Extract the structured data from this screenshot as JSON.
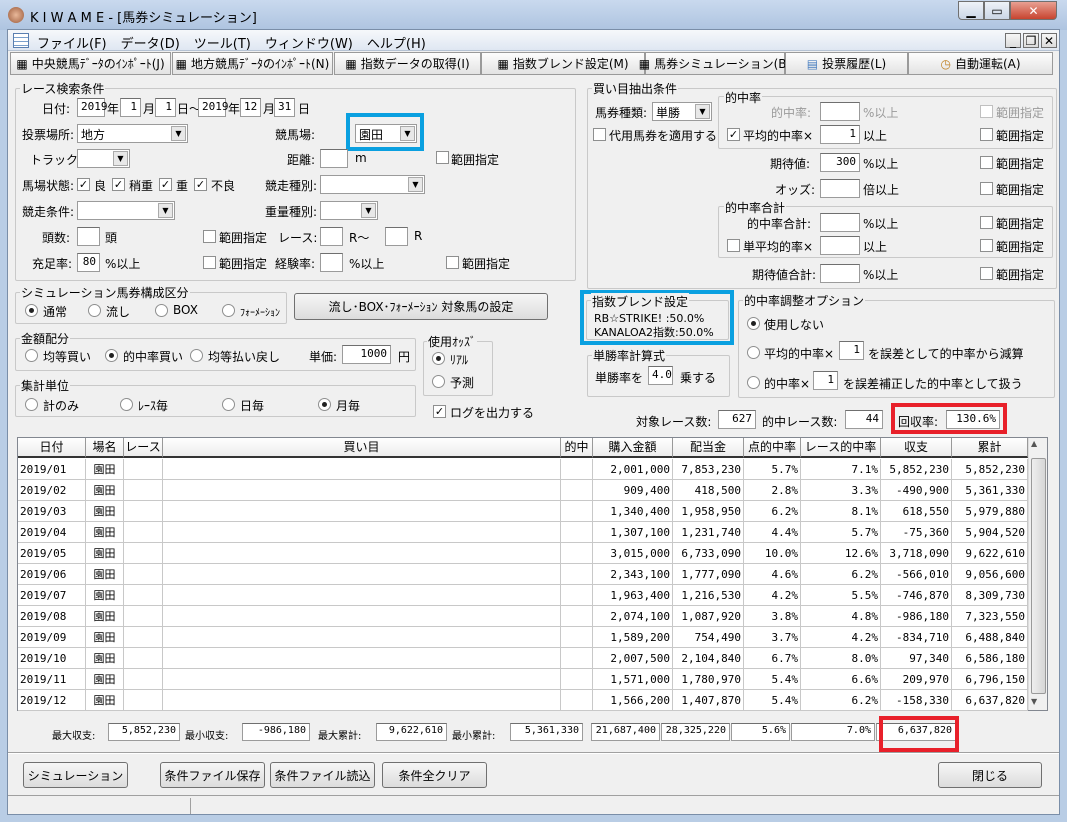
{
  "window": {
    "title": "K I W A M E - [馬券シミュレーション]"
  },
  "menu": [
    "ファイル(F)",
    "データ(D)",
    "ツール(T)",
    "ウィンドウ(W)",
    "ヘルプ(H)"
  ],
  "toolbar": [
    "中央競馬ﾃﾞｰﾀのｲﾝﾎﾟｰﾄ(J)",
    "地方競馬ﾃﾞｰﾀのｲﾝﾎﾟｰﾄ(N)",
    "指数データの取得(I)",
    "指数ブレンド設定(M)",
    "馬券シミュレーション(B)",
    "投票履歴(L)",
    "自動運転(A)"
  ],
  "race": {
    "title": "レース検索条件",
    "date_label": "日付:",
    "from_year": "2019",
    "from_month": "1",
    "from_day": "1",
    "to_year": "2019",
    "to_month": "12",
    "to_day": "31",
    "year": "年",
    "month": "月",
    "day_tilde": "日～",
    "day": "日",
    "venue_label": "投票場所:",
    "venue": "地方",
    "track_place_label": "競馬場:",
    "track_place": "園田",
    "track_label": "トラック:",
    "distance_label": "距離:",
    "distance_unit": "m",
    "range": "範囲指定",
    "ground_label": "馬場状態:",
    "grounds": [
      "良",
      "稍重",
      "重",
      "不良"
    ],
    "race_type_label": "競走種別:",
    "race_cond_label": "競走条件:",
    "weight_label": "重量種別:",
    "heads_label": "頭数:",
    "heads_unit": "頭",
    "race_no_label": "レース:",
    "r_tilde": "R～",
    "r": "R",
    "fill_label": "充足率:",
    "fill": "80",
    "pct_over": "%以上",
    "exp_label": "経験率:"
  },
  "buy": {
    "title": "買い目抽出条件",
    "type_label": "馬券種類:",
    "type": "単勝",
    "substitute": "代用馬券を適用する",
    "hit_group": "的中率",
    "hit_label": "的中率:",
    "avg_hit_label": "平均的中率×",
    "avg_hit": "1",
    "over": "以上",
    "pct_over": "%以上",
    "range": "範囲指定",
    "ev_label": "期待値:",
    "ev": "300",
    "odds_label": "オッズ:",
    "odds_unit": "倍以上",
    "sum_group": "的中率合計",
    "sum_label": "的中率合計:",
    "single_avg_label": "単平均的率×",
    "ev_sum_label": "期待値合計:"
  },
  "composition": {
    "title": "シミュレーション馬券構成区分",
    "options": [
      "通常",
      "流し",
      "BOX",
      "ﾌｫｰﾒｰｼｮﾝ"
    ],
    "selected": 0,
    "button": "流し･BOX･ﾌｫｰﾒｰｼｮﾝ  対象馬の設定"
  },
  "allocation": {
    "title": "金額配分",
    "options": [
      "均等買い",
      "的中率買い",
      "均等払い戻し"
    ],
    "selected": 1,
    "unit_label": "単価:",
    "unit": "1000",
    "yen": "円"
  },
  "odds": {
    "title": "使用ｵｯｽﾞ",
    "options": [
      "ﾘｱﾙ",
      "予測"
    ],
    "selected": 0
  },
  "aggregate": {
    "title": "集計単位",
    "options": [
      "計のみ",
      "ﾚｰｽ毎",
      "日毎",
      "月毎"
    ],
    "selected": 3
  },
  "log": "ログを出力する",
  "blend": {
    "title": "指数ブレンド設定",
    "line1": "RB☆STRIKE! :50.0%",
    "line2": "KANALOA2指数:50.0%"
  },
  "win_rate": {
    "title": "単勝率計算式",
    "label": "単勝率を",
    "value": "4.0",
    "suffix": "乗する"
  },
  "adjust": {
    "title": "的中率調整オプション",
    "opt1": "使用しない",
    "opt2a": "平均的中率×",
    "opt2v": "1",
    "opt2b": "を誤差として的中率から減算",
    "opt3a": "的中率×",
    "opt3v": "1",
    "opt3b": "を誤差補正した的中率として扱う"
  },
  "summary": {
    "target_label": "対象レース数:",
    "target": "627",
    "hit_label": "的中レース数:",
    "hit": "44",
    "recovery_label": "回収率:",
    "recovery": "130.6%"
  },
  "table": {
    "headers": [
      "日付",
      "場名",
      "レース",
      "買い目",
      "的中",
      "購入金額",
      "配当金",
      "点的中率",
      "レース的中率",
      "収支",
      "累計"
    ],
    "rows": [
      [
        "2019/01",
        "園田",
        "",
        "",
        "",
        "2,001,000",
        "7,853,230",
        "5.7%",
        "7.1%",
        "5,852,230",
        "5,852,230"
      ],
      [
        "2019/02",
        "園田",
        "",
        "",
        "",
        "909,400",
        "418,500",
        "2.8%",
        "3.3%",
        "-490,900",
        "5,361,330"
      ],
      [
        "2019/03",
        "園田",
        "",
        "",
        "",
        "1,340,400",
        "1,958,950",
        "6.2%",
        "8.1%",
        "618,550",
        "5,979,880"
      ],
      [
        "2019/04",
        "園田",
        "",
        "",
        "",
        "1,307,100",
        "1,231,740",
        "4.4%",
        "5.7%",
        "-75,360",
        "5,904,520"
      ],
      [
        "2019/05",
        "園田",
        "",
        "",
        "",
        "3,015,000",
        "6,733,090",
        "10.0%",
        "12.6%",
        "3,718,090",
        "9,622,610"
      ],
      [
        "2019/06",
        "園田",
        "",
        "",
        "",
        "2,343,100",
        "1,777,090",
        "4.6%",
        "6.2%",
        "-566,010",
        "9,056,600"
      ],
      [
        "2019/07",
        "園田",
        "",
        "",
        "",
        "1,963,400",
        "1,216,530",
        "4.2%",
        "5.5%",
        "-746,870",
        "8,309,730"
      ],
      [
        "2019/08",
        "園田",
        "",
        "",
        "",
        "2,074,100",
        "1,087,920",
        "3.8%",
        "4.8%",
        "-986,180",
        "7,323,550"
      ],
      [
        "2019/09",
        "園田",
        "",
        "",
        "",
        "1,589,200",
        "754,490",
        "3.7%",
        "4.2%",
        "-834,710",
        "6,488,840"
      ],
      [
        "2019/10",
        "園田",
        "",
        "",
        "",
        "2,007,500",
        "2,104,840",
        "6.7%",
        "8.0%",
        "97,340",
        "6,586,180"
      ],
      [
        "2019/11",
        "園田",
        "",
        "",
        "",
        "1,571,000",
        "1,780,970",
        "5.4%",
        "6.6%",
        "209,970",
        "6,796,150"
      ],
      [
        "2019/12",
        "園田",
        "",
        "",
        "",
        "1,566,200",
        "1,407,870",
        "5.4%",
        "6.2%",
        "-158,330",
        "6,637,820"
      ]
    ]
  },
  "totals": {
    "max_profit_label": "最大収支:",
    "max_profit": "5,852,230",
    "min_profit_label": "最小収支:",
    "min_profit": "-986,180",
    "max_cum_label": "最大累計:",
    "max_cum": "9,622,610",
    "min_cum_label": "最小累計:",
    "min_cum": "5,361,330",
    "purchase": "21,687,400",
    "payout": "28,325,220",
    "point_hit": "5.6%",
    "race_hit": "7.0%",
    "cumulative": "6,637,820"
  },
  "buttons": {
    "simulate": "シミュレーション",
    "save": "条件ファイル保存",
    "load": "条件ファイル読込",
    "clear": "条件全クリア",
    "close": "閉じる"
  }
}
